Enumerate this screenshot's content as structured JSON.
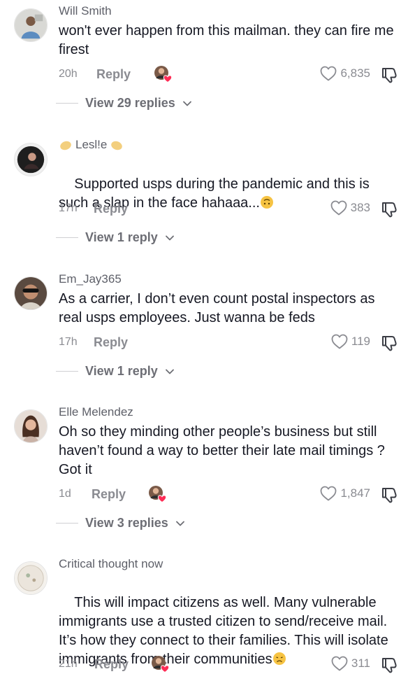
{
  "comments": [
    {
      "username": "Will Smith",
      "text": "won't ever happen from this mailman. they can fire me firest",
      "time": "20h",
      "reply_label": "Reply",
      "likes": "6,835",
      "view_replies": "View 29 replies",
      "creator_liked": true
    },
    {
      "username": "Lesl!e",
      "text": "Supported usps during the pandemic and this is such a slap in the face hahaaa...",
      "time": "17h",
      "reply_label": "Reply",
      "likes": "383",
      "view_replies": "View 1 reply",
      "creator_liked": false
    },
    {
      "username": "Em_Jay365",
      "text": "As a carrier, I don’t even count postal inspectors as real usps employees. Just wanna be feds",
      "time": "17h",
      "reply_label": "Reply",
      "likes": "119",
      "view_replies": "View 1 reply",
      "creator_liked": false
    },
    {
      "username": "Elle Melendez",
      "text": "Oh so they minding other people’s business but still haven’t found a way to better their late mail timings ? Got it",
      "time": "1d",
      "reply_label": "Reply",
      "likes": "1,847",
      "view_replies": "View 3 replies",
      "creator_liked": true
    },
    {
      "username": "Critical thought now",
      "text": "This will impact citizens as well. Many vulnerable immigrants use a trusted citizen to send/receive mail. It’s how they connect to their families. This will isolate immigrants from their communities",
      "time": "21h",
      "reply_label": "Reply",
      "likes": "311",
      "creator_liked": true
    }
  ],
  "icons": {
    "like": "heart-outline-icon",
    "dislike": "thumbs-down-outline-icon",
    "chevron": "chevron-down-icon",
    "creator_badge": "creator-liked-badge-icon"
  },
  "colors": {
    "text": "#161823",
    "muted": "#8a8b91",
    "username": "#5d5f68",
    "creator_heart": "#fe2c55"
  }
}
